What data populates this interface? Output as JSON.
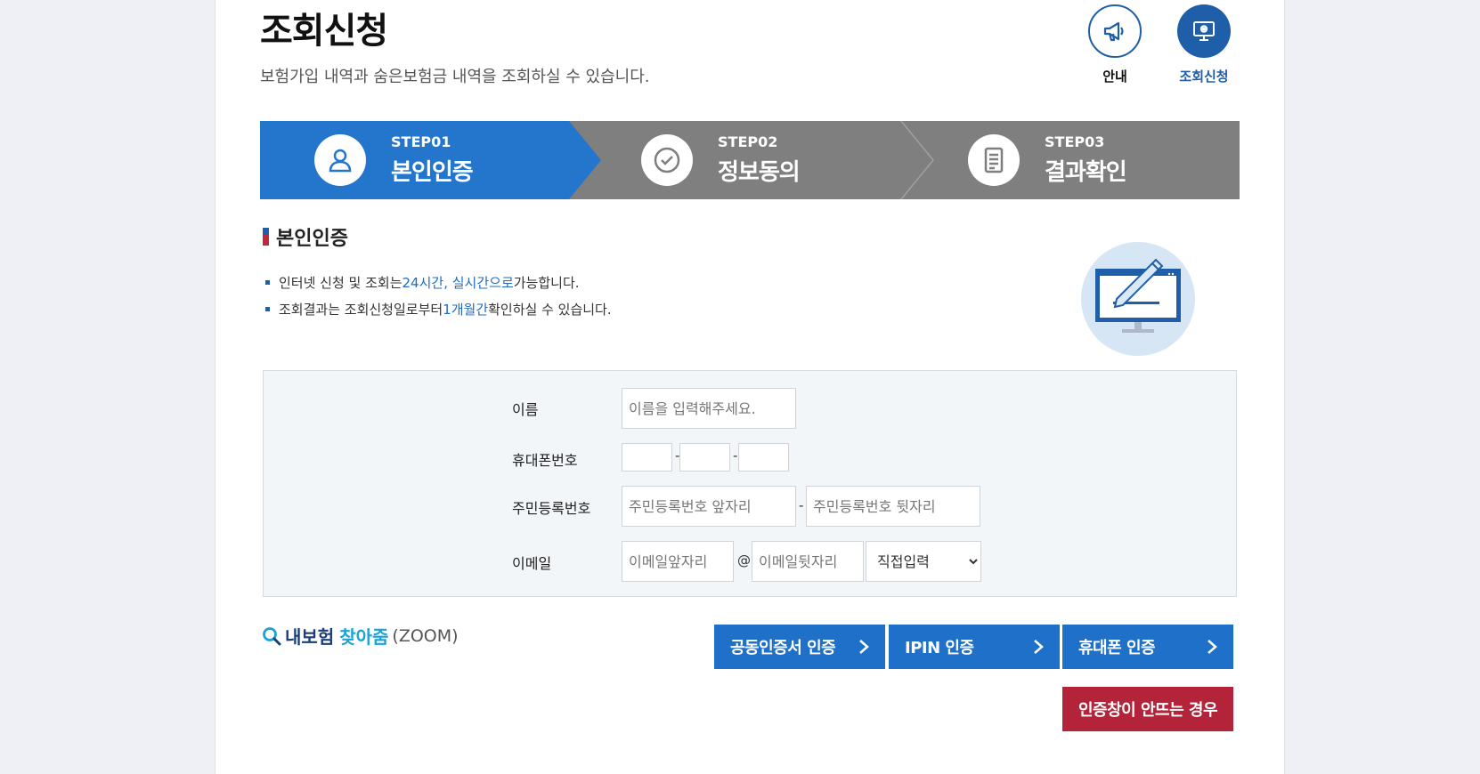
{
  "header": {
    "title": "조회신청",
    "subtitle": "보험가입 내역과 숨은보험금 내역을 조회하실 수 있습니다.",
    "nav": [
      {
        "label": "안내",
        "icon": "megaphone-icon"
      },
      {
        "label": "조회신청",
        "icon": "monitor-icon"
      }
    ]
  },
  "steps": [
    {
      "num": "STEP01",
      "name": "본인인증",
      "icon": "user-icon",
      "active": true
    },
    {
      "num": "STEP02",
      "name": "정보동의",
      "icon": "check-circle-icon",
      "active": false
    },
    {
      "num": "STEP03",
      "name": "결과확인",
      "icon": "document-icon",
      "active": false
    }
  ],
  "section": {
    "title": "본인인증",
    "notes": [
      {
        "pre": "인터넷 신청 및 조회는 ",
        "hl": "24시간, 실시간으로",
        "post": " 가능합니다."
      },
      {
        "pre": "조회결과는 조회신청일로부터 ",
        "hl": "1개월간",
        "post": " 확인하실 수 있습니다."
      }
    ]
  },
  "form": {
    "name_label": "이름",
    "name_placeholder": "이름을 입력해주세요.",
    "phone_label": "휴대폰번호",
    "phone_sep": "-",
    "rrn_label": "주민등록번호",
    "rrn_front_placeholder": "주민등록번호 앞자리",
    "rrn_back_placeholder": "주민등록번호 뒷자리",
    "rrn_sep": "-",
    "email_label": "이메일",
    "email_front_placeholder": "이메일앞자리",
    "email_at": "@",
    "email_back_placeholder": "이메일뒷자리",
    "email_domain_selected": "직접입력"
  },
  "zoom": {
    "part1": "내보험",
    "part2": "찾아줌",
    "part3": "(ZOOM)"
  },
  "buttons": {
    "cert": "공동인증서 인증",
    "ipin": "IPIN 인증",
    "phone": "휴대폰 인증",
    "fail": "인증창이 안뜨는 경우",
    "arrow_icon": "chevron-right-icon"
  },
  "colors": {
    "primary": "#1f70c8",
    "navy": "#1f5ea8",
    "step_inactive": "#7f7f7f",
    "danger": "#b3243a"
  }
}
